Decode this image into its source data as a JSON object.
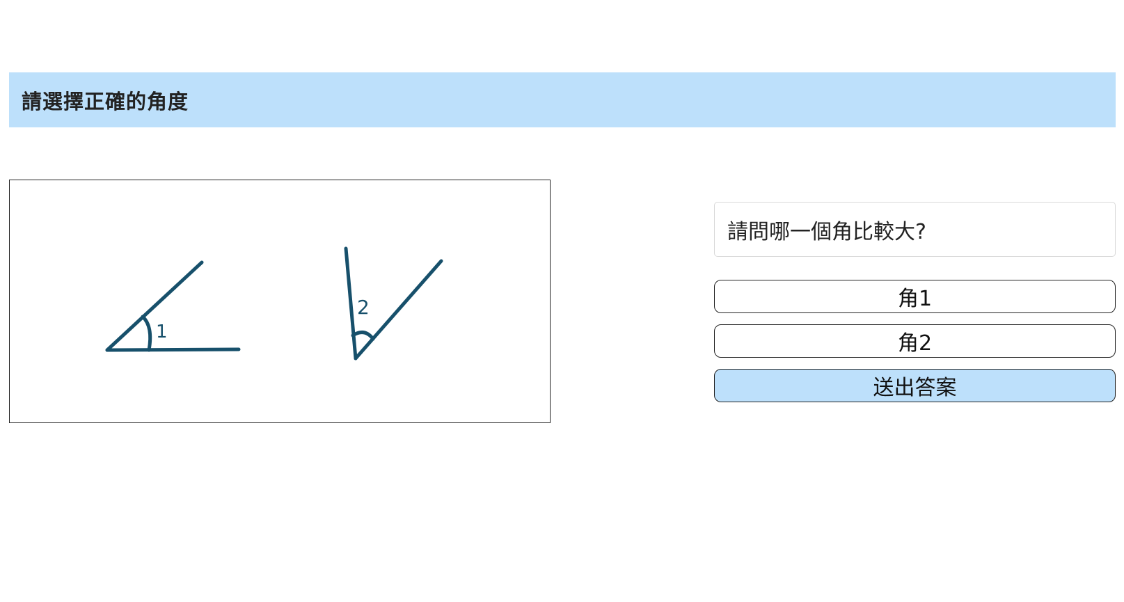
{
  "header": {
    "title": "請選擇正確的角度"
  },
  "figure": {
    "angle_labels": [
      "1",
      "2"
    ],
    "stroke_color": "#17506b"
  },
  "question": {
    "text": "請問哪一個角比較大?"
  },
  "options": [
    {
      "label": "角1"
    },
    {
      "label": "角2"
    }
  ],
  "submit": {
    "label": "送出答案"
  },
  "colors": {
    "header_bg": "#bde0fb",
    "submit_bg": "#bde0fb",
    "angle_stroke": "#17506b"
  }
}
